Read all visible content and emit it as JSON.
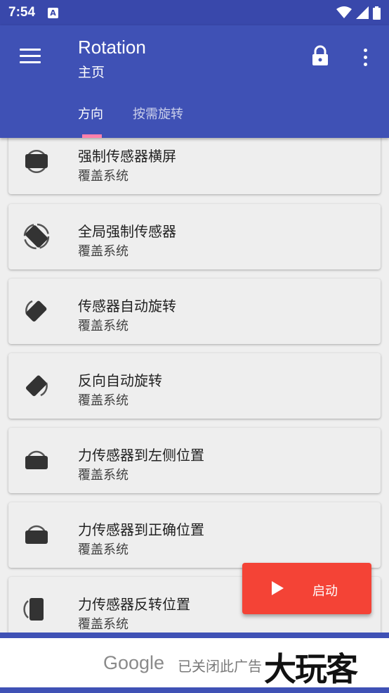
{
  "status_bar": {
    "time": "7:54",
    "notification_letter": "A"
  },
  "app_bar": {
    "title": "Rotation",
    "subtitle": "主页",
    "tabs": [
      {
        "label": "方向",
        "selected": true
      },
      {
        "label": "按需旋转",
        "selected": false
      }
    ]
  },
  "modes": [
    {
      "title": "强制传感器横屏",
      "subtitle": "覆盖系统",
      "icon": "landscape-rotate-icon"
    },
    {
      "title": "全局强制传感器",
      "subtitle": "覆盖系统",
      "icon": "screen-rotation-icon"
    },
    {
      "title": "传感器自动旋转",
      "subtitle": "覆盖系统",
      "icon": "auto-rotate-icon"
    },
    {
      "title": "反向自动旋转",
      "subtitle": "覆盖系统",
      "icon": "reverse-rotate-icon"
    },
    {
      "title": "力传感器到左侧位置",
      "subtitle": "覆盖系统",
      "icon": "landscape-left-icon"
    },
    {
      "title": "力传感器到正确位置",
      "subtitle": "覆盖系统",
      "icon": "landscape-right-icon"
    },
    {
      "title": "力传感器反转位置",
      "subtitle": "覆盖系统",
      "icon": "portrait-reverse-icon"
    }
  ],
  "fab": {
    "label": "启动"
  },
  "ad": {
    "brand": "Google",
    "close_text": "已关闭此广告",
    "watermark": "大玩客"
  },
  "colors": {
    "primary": "#3f51b5",
    "status_bar": "#3948ab",
    "accent": "#f44336",
    "tab_indicator": "#ff80ab",
    "card": "#eeeeee"
  }
}
